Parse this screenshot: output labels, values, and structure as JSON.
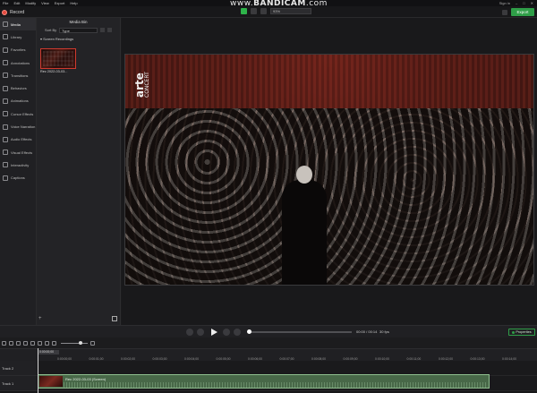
{
  "menu": [
    "File",
    "Edit",
    "Modify",
    "View",
    "Export",
    "Help"
  ],
  "watermark": {
    "www": "www.",
    "brand": "BANDICAM",
    "tld": ".com"
  },
  "top_right": {
    "sign_in": "Sign in"
  },
  "toolbar": {
    "record_label": "Record",
    "zoom_value": "93%",
    "export_label": "Export"
  },
  "nav": [
    {
      "label": "Media",
      "icon": "media-icon"
    },
    {
      "label": "Library",
      "icon": "library-icon"
    },
    {
      "label": "Favorites",
      "icon": "favorites-icon"
    },
    {
      "label": "Annotations",
      "icon": "annotations-icon"
    },
    {
      "label": "Transitions",
      "icon": "transitions-icon"
    },
    {
      "label": "Behaviors",
      "icon": "behaviors-icon"
    },
    {
      "label": "Animations",
      "icon": "animations-icon"
    },
    {
      "label": "Cursor Effects",
      "icon": "cursor-effects-icon"
    },
    {
      "label": "Voice Narration",
      "icon": "voice-narration-icon"
    },
    {
      "label": "Audio Effects",
      "icon": "audio-effects-icon"
    },
    {
      "label": "Visual Effects",
      "icon": "visual-effects-icon"
    },
    {
      "label": "Interactivity",
      "icon": "interactivity-icon"
    },
    {
      "label": "Captions",
      "icon": "captions-icon"
    }
  ],
  "media_bin": {
    "title": "Media Bin",
    "sort_label": "Sort By",
    "sort_value": "Type",
    "section": "Screen Recordings",
    "thumb_label": "Rec 2022-03-03..."
  },
  "video": {
    "logo_text": "arte",
    "logo_sub": "CONCERT"
  },
  "playback": {
    "time": "00:00 / 00:14",
    "fps": "30 fps",
    "properties": "Properties"
  },
  "timeline": {
    "playhead_time": "0:00:00;00",
    "ruler_ticks": [
      "0:00:00;00",
      "0:00:01;00",
      "0:00:02;00",
      "0:00:03;00",
      "0:00:04;00",
      "0:00:05;00",
      "0:00:06;00",
      "0:00:07;00",
      "0:00:08;00",
      "0:00:09;00",
      "0:00:10;00",
      "0:00:11;00",
      "0:00:12;00",
      "0:00:13;00",
      "0:00:14;00"
    ],
    "tracks": [
      "Track 2",
      "Track 1"
    ],
    "clip_label": "Rec 2022-03-03 (Screen)"
  }
}
